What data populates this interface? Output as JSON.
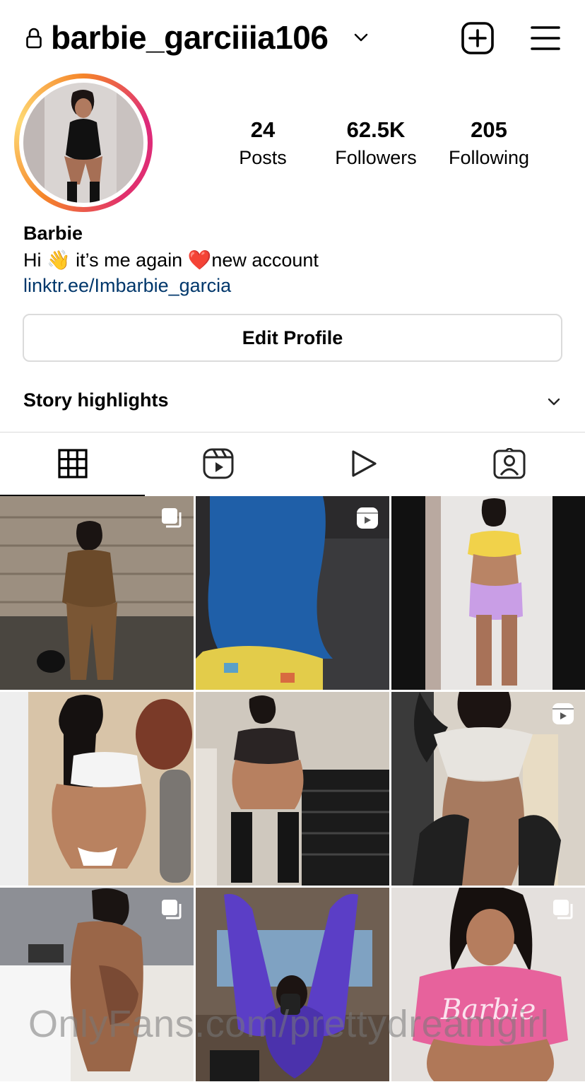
{
  "header": {
    "username": "barbie_garciiia106",
    "lock_icon": "lock-icon",
    "switcher_icon": "chevron-down-icon",
    "new_post_icon": "plus-square-icon",
    "menu_icon": "hamburger-menu-icon"
  },
  "profile": {
    "stats": [
      {
        "value": "24",
        "label": "Posts"
      },
      {
        "value": "62.5K",
        "label": "Followers"
      },
      {
        "value": "205",
        "label": "Following"
      }
    ],
    "name": "Barbie",
    "bio": "Hi 👋 it’s me again ❤️new account",
    "link": "linktr.ee/Imbarbie_garcia"
  },
  "actions": {
    "edit_profile": "Edit Profile"
  },
  "highlights": {
    "label": "Story highlights"
  },
  "tabs": [
    {
      "icon": "grid-icon",
      "active": true
    },
    {
      "icon": "reels-icon",
      "active": false
    },
    {
      "icon": "play-icon",
      "active": false
    },
    {
      "icon": "tagged-icon",
      "active": false
    }
  ],
  "posts": [
    {
      "badge": "carousel-icon"
    },
    {
      "badge": "reel-icon"
    },
    {
      "badge": ""
    },
    {
      "badge": ""
    },
    {
      "badge": ""
    },
    {
      "badge": "reel-icon"
    },
    {
      "badge": "carousel-icon"
    },
    {
      "badge": ""
    },
    {
      "badge": "carousel-icon"
    }
  ],
  "watermark": "OnlyFans.com/prettydreamgirl",
  "colors": {
    "link": "#00376b",
    "border": "#dbdbdb",
    "ring_start": "#f58529",
    "ring_mid": "#dd2a7b"
  }
}
